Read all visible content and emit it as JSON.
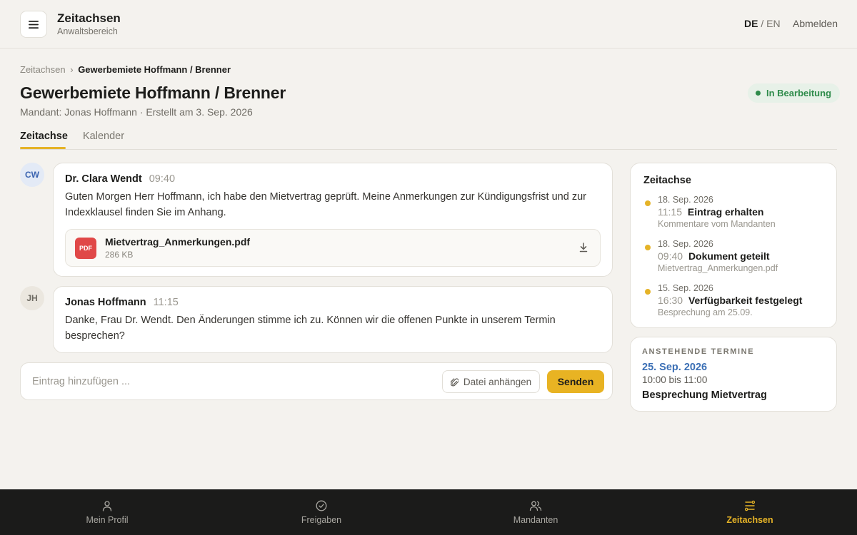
{
  "header": {
    "title": "Zeitachsen",
    "subtitle": "Anwaltsbereich",
    "lang_active": "DE",
    "lang_separator": "/",
    "lang_other": "EN",
    "logout_label": "Abmelden"
  },
  "breadcrumb": {
    "root": "Zeitachsen",
    "separator": "›",
    "current": "Gewerbemiete Hoffmann / Brenner"
  },
  "page": {
    "title": "Gewerbemiete Hoffmann / Brenner",
    "meta": "Mandant: Jonas Hoffmann · Erstellt am 3. Sep. 2026",
    "status": "In Bearbeitung"
  },
  "tabs": [
    {
      "label": "Zeitachse",
      "active": true
    },
    {
      "label": "Kalender",
      "active": false
    }
  ],
  "messages": [
    {
      "initials": "CW",
      "author": "Dr. Clara Wendt",
      "time": "09:40",
      "text": "Guten Morgen Herr Hoffmann, ich habe den Mietvertrag geprüft. Meine Anmerkungen zur Kündigungsfrist und zur Indexklausel finden Sie im Anhang.",
      "attachment": {
        "type_label": "PDF",
        "name": "Mietvertrag_Anmerkungen.pdf",
        "size": "286 KB"
      }
    },
    {
      "initials": "JH",
      "author": "Jonas Hoffmann",
      "time": "11:15",
      "text": "Danke, Frau Dr. Wendt. Den Änderungen stimme ich zu. Können wir die offenen Punkte in unserem Termin besprechen?"
    }
  ],
  "composer": {
    "placeholder": "Eintrag hinzufügen ...",
    "value": "",
    "attach_label": "Datei anhängen",
    "send_label": "Senden"
  },
  "timeline": {
    "title": "Zeitachse",
    "items": [
      {
        "date": "18. Sep. 2026",
        "time": "11:15",
        "title": "Eintrag erhalten",
        "desc": "Kommentare vom Mandanten"
      },
      {
        "date": "18. Sep. 2026",
        "time": "09:40",
        "title": "Dokument geteilt",
        "desc": "Mietvertrag_Anmerkungen.pdf"
      },
      {
        "date": "15. Sep. 2026",
        "time": "16:30",
        "title": "Verfügbarkeit festgelegt",
        "desc": "Besprechung am 25.09."
      }
    ]
  },
  "upcoming": {
    "label": "ANSTEHENDE TERMINE",
    "date": "25. Sep. 2026",
    "time": "10:00 bis 11:00",
    "title": "Besprechung Mietvertrag"
  },
  "bottom_nav": [
    {
      "label": "Mein Profil",
      "icon": "user-icon",
      "active": false
    },
    {
      "label": "Freigaben",
      "icon": "check-circle-icon",
      "active": false
    },
    {
      "label": "Mandanten",
      "icon": "users-icon",
      "active": false
    },
    {
      "label": "Zeitachsen",
      "icon": "timeline-list-icon",
      "active": true
    }
  ],
  "colors": {
    "accent": "#e5b327",
    "status_green": "#2e8b4a",
    "link_blue": "#3b6fb5",
    "pdf_red": "#e04848"
  }
}
